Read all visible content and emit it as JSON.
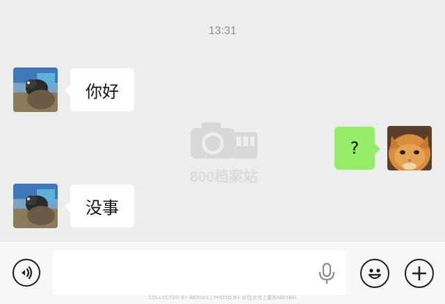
{
  "chat": {
    "timestamp": "13:31",
    "messages": [
      {
        "side": "left",
        "text": "你好",
        "avatar": "contact-avatar"
      },
      {
        "side": "right",
        "text": "?",
        "avatar": "cat-avatar"
      },
      {
        "side": "left",
        "text": "没事",
        "avatar": "contact-avatar"
      }
    ]
  },
  "watermark": {
    "icon": "camera-bus-icon",
    "text": "800档案站"
  },
  "input_bar": {
    "voice_icon": "voice-icon",
    "text_value": "",
    "mic_icon": "microphone-icon",
    "emoji_icon": "emoji-icon",
    "plus_icon": "plus-icon"
  },
  "footer": {
    "credit": "COLLECTED BY 800DAS | PHOTO BY @找大对上要的MGSBG"
  },
  "colors": {
    "background": "#ededed",
    "incoming_bubble": "#ffffff",
    "outgoing_bubble": "#95ec69",
    "input_bar": "#f7f7f7"
  }
}
